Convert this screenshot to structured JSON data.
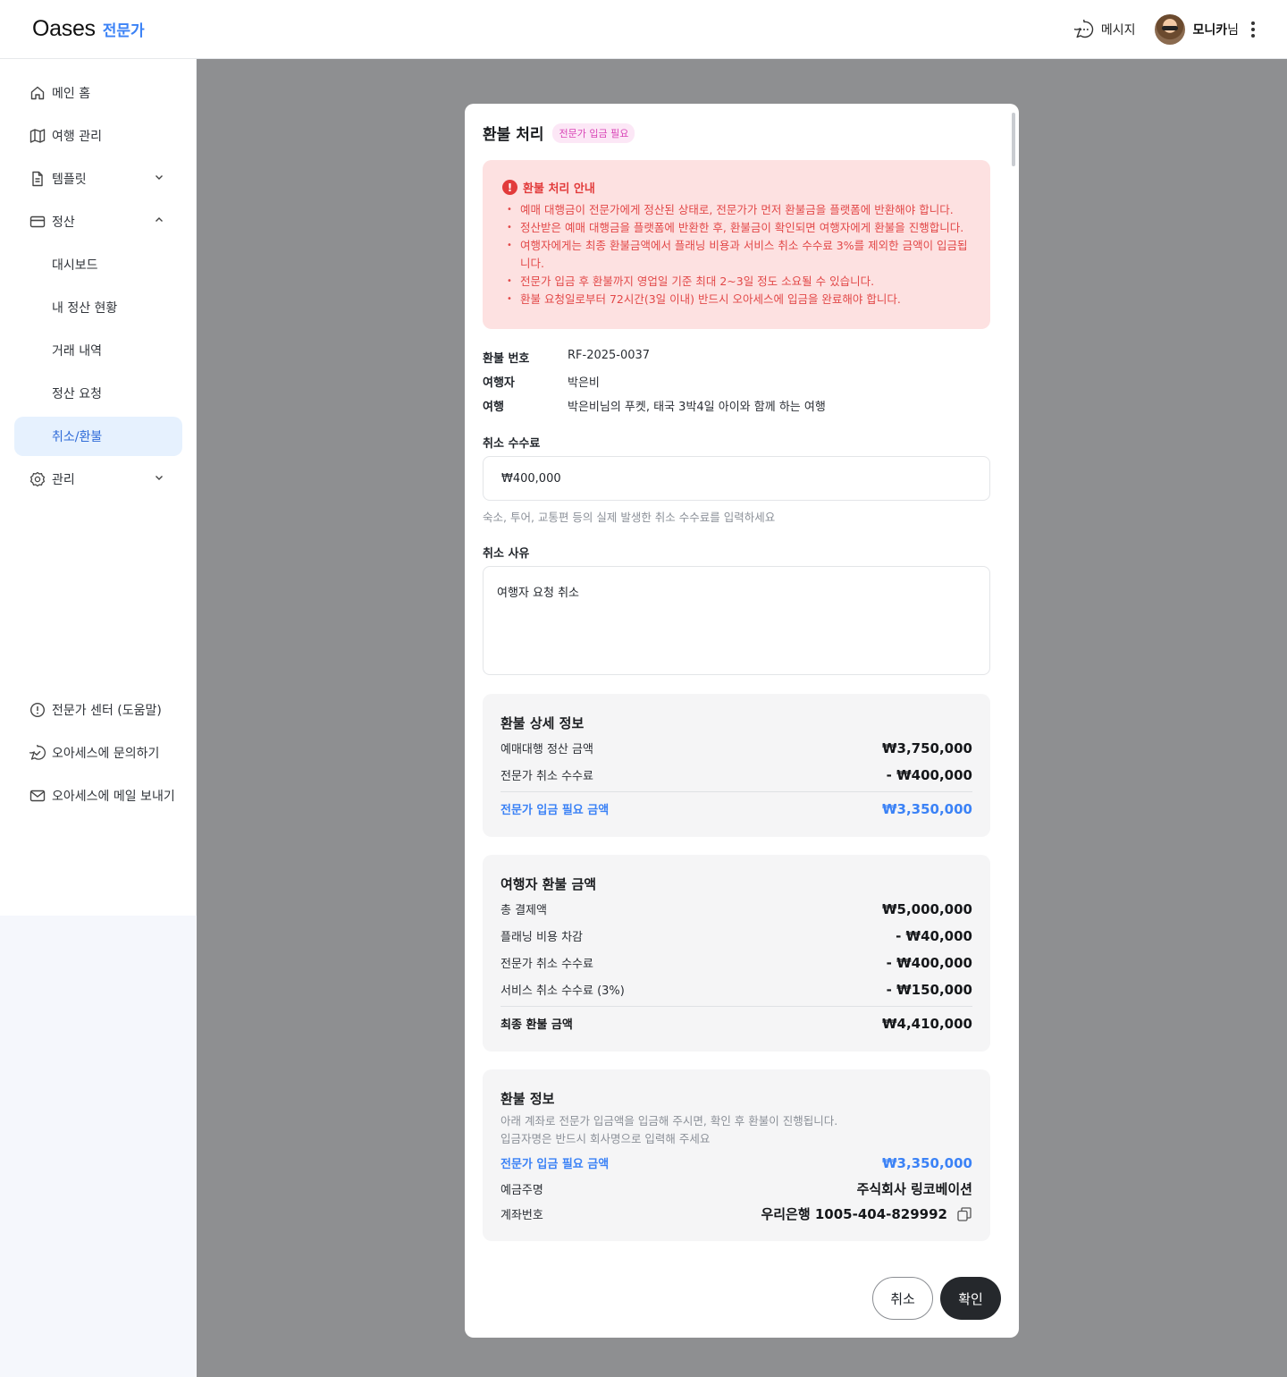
{
  "header": {
    "brand": "Oases",
    "brand_sub": "전문가",
    "message_label": "메시지",
    "user_name": "모니카",
    "user_suffix": "님"
  },
  "sidebar": {
    "items": [
      {
        "label": "메인 홈",
        "icon": "home-icon"
      },
      {
        "label": "여행 관리",
        "icon": "map-icon"
      },
      {
        "label": "템플릿",
        "icon": "document-icon"
      },
      {
        "label": "정산",
        "icon": "card-icon"
      },
      {
        "label": "대시보드"
      },
      {
        "label": "내 정산 현황"
      },
      {
        "label": "거래 내역"
      },
      {
        "label": "정산 요청"
      },
      {
        "label": "취소/환불"
      },
      {
        "label": "관리",
        "icon": "gear-icon"
      }
    ],
    "footer": [
      {
        "label": "전문가 센터 (도움말)",
        "icon": "info-icon"
      },
      {
        "label": "오아세스에 문의하기",
        "icon": "chat-check-icon"
      },
      {
        "label": "오아세스에 메일 보내기",
        "icon": "mail-icon"
      }
    ]
  },
  "modal": {
    "title": "환불 처리",
    "badge": "전문가 입금 필요",
    "alert": {
      "title": "환불 처리 안내",
      "items": [
        "예매 대행금이 전문가에게 정산된 상태로, 전문가가 먼저 환불금을 플랫폼에 반환해야 합니다.",
        "정산받은 예매 대행금을 플랫폼에 반환한 후, 환불금이 확인되면 여행자에게 환불을 진행합니다.",
        "여행자에게는 최종 환불금액에서 플래닝 비용과 서비스 취소 수수료 3%를 제외한 금액이 입금됩니다.",
        "전문가 입금 후 환불까지 영업일 기준 최대 2~3일 정도 소요될 수 있습니다.",
        "환불 요청일로부터 72시간(3일 이내) 반드시 오아세스에 입금을 완료해야 합니다."
      ]
    },
    "info": {
      "refund_no_label": "환불 번호",
      "refund_no": "RF-2025-0037",
      "traveler_label": "여행자",
      "traveler": "박은비",
      "trip_label": "여행",
      "trip": "박은비님의 푸켓, 태국 3박4일 아이와 함께 하는 여행"
    },
    "fee": {
      "label": "취소 수수료",
      "value": "₩400,000",
      "hint": "숙소, 투어, 교통편 등의 실제 발생한 취소 수수료를 입력하세요"
    },
    "reason": {
      "label": "취소 사유",
      "value": "여행자 요청 취소"
    },
    "detail": {
      "title": "환불 상세 정보",
      "settled_label": "예매대행 정산 금액",
      "settled": "₩3,750,000",
      "fee_label": "전문가 취소 수수료",
      "fee": "- ₩400,000",
      "deposit_label": "전문가 입금 필요 금액",
      "deposit": "₩3,350,000"
    },
    "traveler_refund": {
      "title": "여행자 환불 금액",
      "total_label": "총 결제액",
      "total": "₩5,000,000",
      "planning_label": "플래닝 비용 차감",
      "planning": "- ₩40,000",
      "expert_fee_label": "전문가 취소 수수료",
      "expert_fee": "- ₩400,000",
      "service_fee_label": "서비스 취소 수수료 (3%)",
      "service_fee": "- ₩150,000",
      "final_label": "최종 환불 금액",
      "final": "₩4,410,000"
    },
    "refund_info": {
      "title": "환불 정보",
      "note1": "아래 계좌로 전문가 입금액을 입금해 주시면, 확인 후 환불이 진행됩니다.",
      "note2": "입금자명은 반드시 회사명으로 입력해 주세요",
      "deposit_label": "전문가 입금 필요 금액",
      "deposit": "₩3,350,000",
      "holder_label": "예금주명",
      "holder": "주식회사 링코베이션",
      "account_label": "계좌번호",
      "account": "우리은행 1005-404-829992"
    },
    "cancel_label": "취소",
    "confirm_label": "확인"
  },
  "colors": {
    "accent": "#3b82f6",
    "alert_bg": "#fde1e1",
    "alert_text": "#e23b3b",
    "active_nav_bg": "#e6f1fe",
    "overlay": "#8e8f91"
  }
}
